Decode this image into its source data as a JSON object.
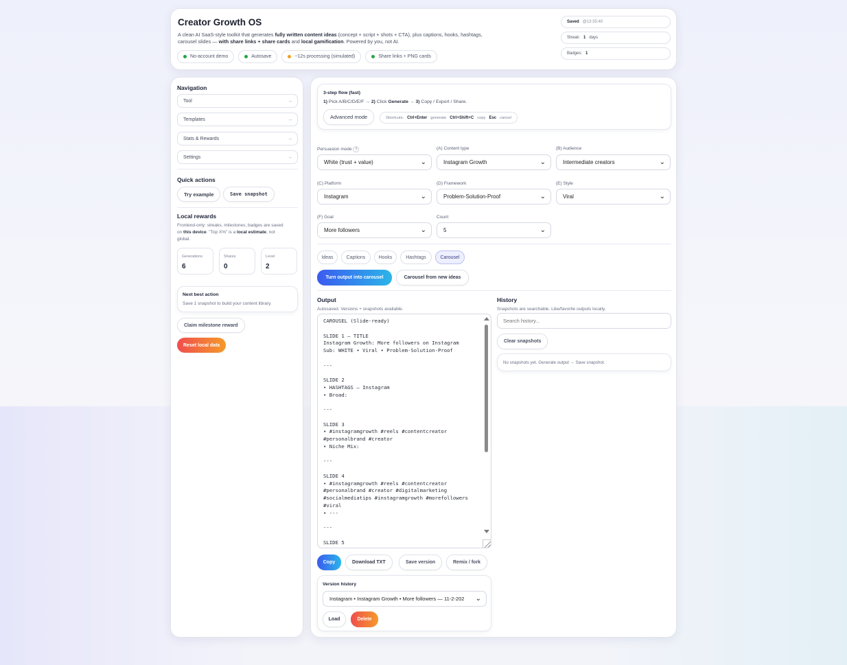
{
  "header": {
    "title": "Creator Growth OS",
    "desc_1": "A clean AI SaaS-style toolkit that generates ",
    "desc_b1": "fully written content ideas",
    "desc_2": " (concept + script + shots + CTA), plus captions, hooks, hashtags,",
    "desc_3": "carousel slides — ",
    "desc_b2": "with share links + share cards",
    "desc_4": " and ",
    "desc_b3": "local gamification",
    "desc_5": ". Powered by you, not AI.",
    "pills": [
      {
        "label": "No-account demo",
        "color": "#22a447"
      },
      {
        "label": "Autosave",
        "color": "#22a447"
      },
      {
        "label": "~12s processing (simulated)",
        "color": "#f0a020"
      },
      {
        "label": "Share links + PNG cards",
        "color": "#22a447"
      }
    ],
    "saved_label": "Saved",
    "saved_time": "@13:35:40",
    "streak_label": "Streak:",
    "streak_value": "1",
    "streak_unit": "days",
    "badges_label": "Badges:",
    "badges_value": "1"
  },
  "sidebar": {
    "nav_title": "Navigation",
    "nav_items": [
      "Tool",
      "Templates",
      "Stats & Rewards",
      "Settings"
    ],
    "nav_arrow": "→",
    "quick_title": "Quick actions",
    "try_example": "Try example",
    "save_snapshot": "Save snapshot",
    "rewards_title": "Local rewards",
    "rewards_desc_1": "Frontend-only: streaks, milestones, badges are saved",
    "rewards_desc_2a": "on ",
    "rewards_desc_2b": "this device",
    "rewards_desc_2c": ". \"Top X%\" is a ",
    "rewards_desc_2d": "local estimate",
    "rewards_desc_2e": ", not",
    "rewards_desc_3": "global.",
    "stats": [
      {
        "label": "Generations",
        "value": "6"
      },
      {
        "label": "Shares",
        "value": "0"
      },
      {
        "label": "Level",
        "value": "2"
      }
    ],
    "next_title": "Next best action",
    "next_desc": "Save 1 snapshot to build your content library.",
    "claim": "Claim milestone reward",
    "reset": "Reset local data"
  },
  "flow": {
    "title": "3-step flow (fast)",
    "s1": "1)",
    "s1t": " Pick A/B/C/D/E/F → ",
    "s2": "2)",
    "s2t": " Click ",
    "s2b": "Generate",
    "s2c": " → ",
    "s3": "3)",
    "s3t": " Copy / Export / Share.",
    "advanced": "Advanced mode",
    "shortcuts_label": "Shortcuts:",
    "k1": "Ctrl+Enter",
    "k1t": "generate",
    "k2": "Ctrl+Shift+C",
    "k2t": "copy",
    "k3": "Esc",
    "k3t": "cancel"
  },
  "form": {
    "persuasion_label": "Persuasion mode",
    "persuasion_help": "?",
    "persuasion_value": "White (trust + value)",
    "content_label": "(A) Content type",
    "content_value": "Instagram Growth",
    "audience_label": "(B) Audience",
    "audience_value": "Intermediate creators",
    "platform_label": "(C) Platform",
    "platform_value": "Instagram",
    "framework_label": "(D) Framework",
    "framework_value": "Problem-Solution-Proof",
    "style_label": "(E) Style",
    "style_value": "Viral",
    "goal_label": "(F) Goal",
    "goal_value": "More followers",
    "count_label": "Count",
    "count_value": "5"
  },
  "tabs": [
    "Ideas",
    "Captions",
    "Hooks",
    "Hashtags",
    "Carousel"
  ],
  "actions": {
    "turn": "Turn output into carousel",
    "from_new": "Carousel from new ideas"
  },
  "output": {
    "title": "Output",
    "sub": "Autosaved. Versions + snapshots available.",
    "text": "CAROUSEL (Slide-ready)\n\nSLIDE 1 — TITLE\nInstagram Growth: More followers on Instagram\nSub: WHITE • Viral • Problem-Solution-Proof\n\n---\n\nSLIDE 2\n• HASHTAGS — Instagram\n• Broad:\n\n---\n\nSLIDE 3\n• #instagramgrowth #reels #contentcreator\n#personalbrand #creator\n• Niche Mix:\n\n---\n\nSLIDE 4\n• #instagramgrowth #reels #contentcreator\n#personalbrand #creator #digitalmarketing\n#socialmediatips #instagramgrowth #morefollowers\n#viral\n• ---\n\n---\n\nSLIDE 5",
    "copy": "Copy",
    "download": "Download TXT",
    "save_version": "Save version",
    "remix": "Remix / fork",
    "version_title": "Version history",
    "version_value": "Instagram • Instagram Growth • More followers — 11-2-202",
    "load": "Load",
    "delete": "Delete"
  },
  "history": {
    "title": "History",
    "sub": "Snapshots are searchable. Like/favorite outputs locally.",
    "search_placeholder": "Search history...",
    "clear": "Clear snapshots",
    "empty": "No snapshots yet. Generate output → Save snapshot."
  }
}
